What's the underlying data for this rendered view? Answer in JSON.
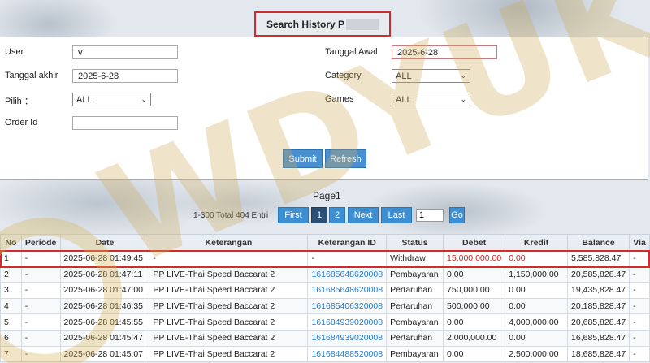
{
  "title": "Search History P",
  "form": {
    "user_label": "User",
    "user_value": "v",
    "tanggal_awal_label": "Tanggal Awal",
    "tanggal_awal_value": "2025-6-28",
    "tanggal_akhir_label": "Tanggal akhir",
    "tanggal_akhir_value": "2025-6-28",
    "category_label": "Category",
    "category_value": "ALL",
    "pilih_label": "Pilih ：",
    "pilih_value": "ALL",
    "games_label": "Games",
    "games_value": "ALL",
    "order_id_label": "Order Id",
    "order_id_value": "",
    "submit_label": "Submit",
    "refresh_label": "Refresh"
  },
  "pagination": {
    "page_label": "Page1",
    "total_text": "1-300 Total 404 Entri",
    "first_label": "First",
    "page1_label": "1",
    "page2_label": "2",
    "next_label": "Next",
    "last_label": "Last",
    "page_input_value": "1",
    "go_label": "Go"
  },
  "watermark": "WDYUK",
  "table": {
    "headers": [
      "No",
      "Periode",
      "Date",
      "Keterangan",
      "Keterangan ID",
      "Status",
      "Debet",
      "Kredit",
      "Balance",
      "Via"
    ],
    "rows": [
      [
        "1",
        "-",
        "2025-06-28 01:49:45",
        "-",
        "-",
        "Withdraw",
        "15,000,000.00",
        "0.00",
        "5,585,828.47",
        "-"
      ],
      [
        "2",
        "-",
        "2025-06-28 01:47:11",
        "PP LIVE-Thai Speed Baccarat 2",
        "161685648620008",
        "Pembayaran",
        "0.00",
        "1,150,000.00",
        "20,585,828.47",
        "-"
      ],
      [
        "3",
        "-",
        "2025-06-28 01:47:00",
        "PP LIVE-Thai Speed Baccarat 2",
        "161685648620008",
        "Pertaruhan",
        "750,000.00",
        "0.00",
        "19,435,828.47",
        "-"
      ],
      [
        "4",
        "-",
        "2025-06-28 01:46:35",
        "PP LIVE-Thai Speed Baccarat 2",
        "161685406320008",
        "Pertaruhan",
        "500,000.00",
        "0.00",
        "20,185,828.47",
        "-"
      ],
      [
        "5",
        "-",
        "2025-06-28 01:45:55",
        "PP LIVE-Thai Speed Baccarat 2",
        "161684939020008",
        "Pembayaran",
        "0.00",
        "4,000,000.00",
        "20,685,828.47",
        "-"
      ],
      [
        "6",
        "-",
        "2025-06-28 01:45:47",
        "PP LIVE-Thai Speed Baccarat 2",
        "161684939020008",
        "Pertaruhan",
        "2,000,000.00",
        "0.00",
        "16,685,828.47",
        "-"
      ],
      [
        "7",
        "-",
        "2025-06-28 01:45:07",
        "PP LIVE-Thai Speed Baccarat 2",
        "161684488520008",
        "Pembayaran",
        "0.00",
        "2,500,000.00",
        "18,685,828.47",
        "-"
      ]
    ]
  },
  "colors": {
    "accent": "#4a90d0",
    "highlight": "#d32b2b",
    "link": "#2a7bc8"
  }
}
